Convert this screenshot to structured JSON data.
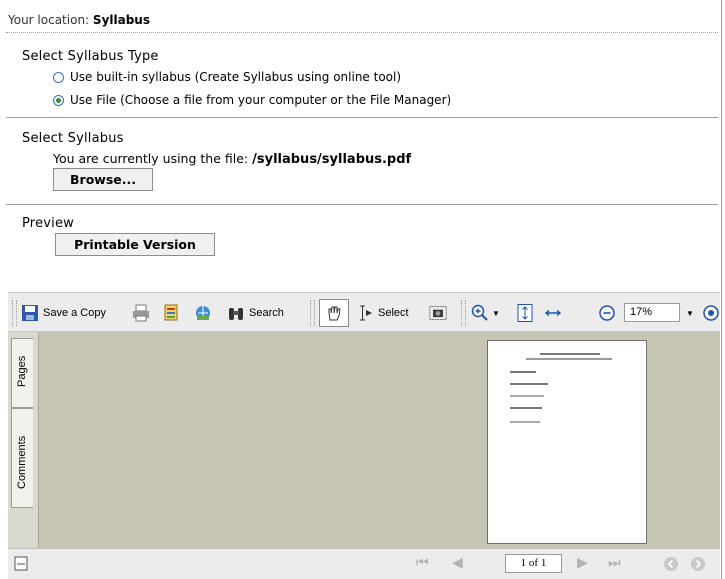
{
  "location": {
    "prefix": "Your location:",
    "current": "Syllabus"
  },
  "syllabus_type": {
    "title": "Select Syllabus Type",
    "options": [
      {
        "label": "Use built-in syllabus  (Create Syllabus using online tool)",
        "selected": false
      },
      {
        "label": "Use File  (Choose a file from your computer or the File Manager)",
        "selected": true
      }
    ]
  },
  "select_syllabus": {
    "title": "Select Syllabus",
    "current_prefix": "You are currently using the file:",
    "current_file": "/syllabus/syllabus.pdf",
    "browse_label": "Browse..."
  },
  "preview": {
    "title": "Preview",
    "printable_label": "Printable Version"
  },
  "pdf_toolbar": {
    "save_copy": "Save a Copy",
    "search": "Search",
    "select": "Select",
    "zoom_value": "17%",
    "icons": [
      "save-icon",
      "print-icon",
      "email-icon",
      "web-icon",
      "binoculars-icon",
      "hand-tool-icon",
      "text-select-icon",
      "snapshot-icon",
      "zoom-in-icon",
      "fit-page-icon",
      "fit-width-icon",
      "zoom-out-icon",
      "zoom-plus-icon"
    ]
  },
  "side_tabs": {
    "pages": "Pages",
    "comments": "Comments"
  },
  "page_nav": {
    "page_label": "1 of 1"
  },
  "colors": {
    "radio_selected": "#2d8a3a",
    "doc_background": "#c7c5b4"
  }
}
